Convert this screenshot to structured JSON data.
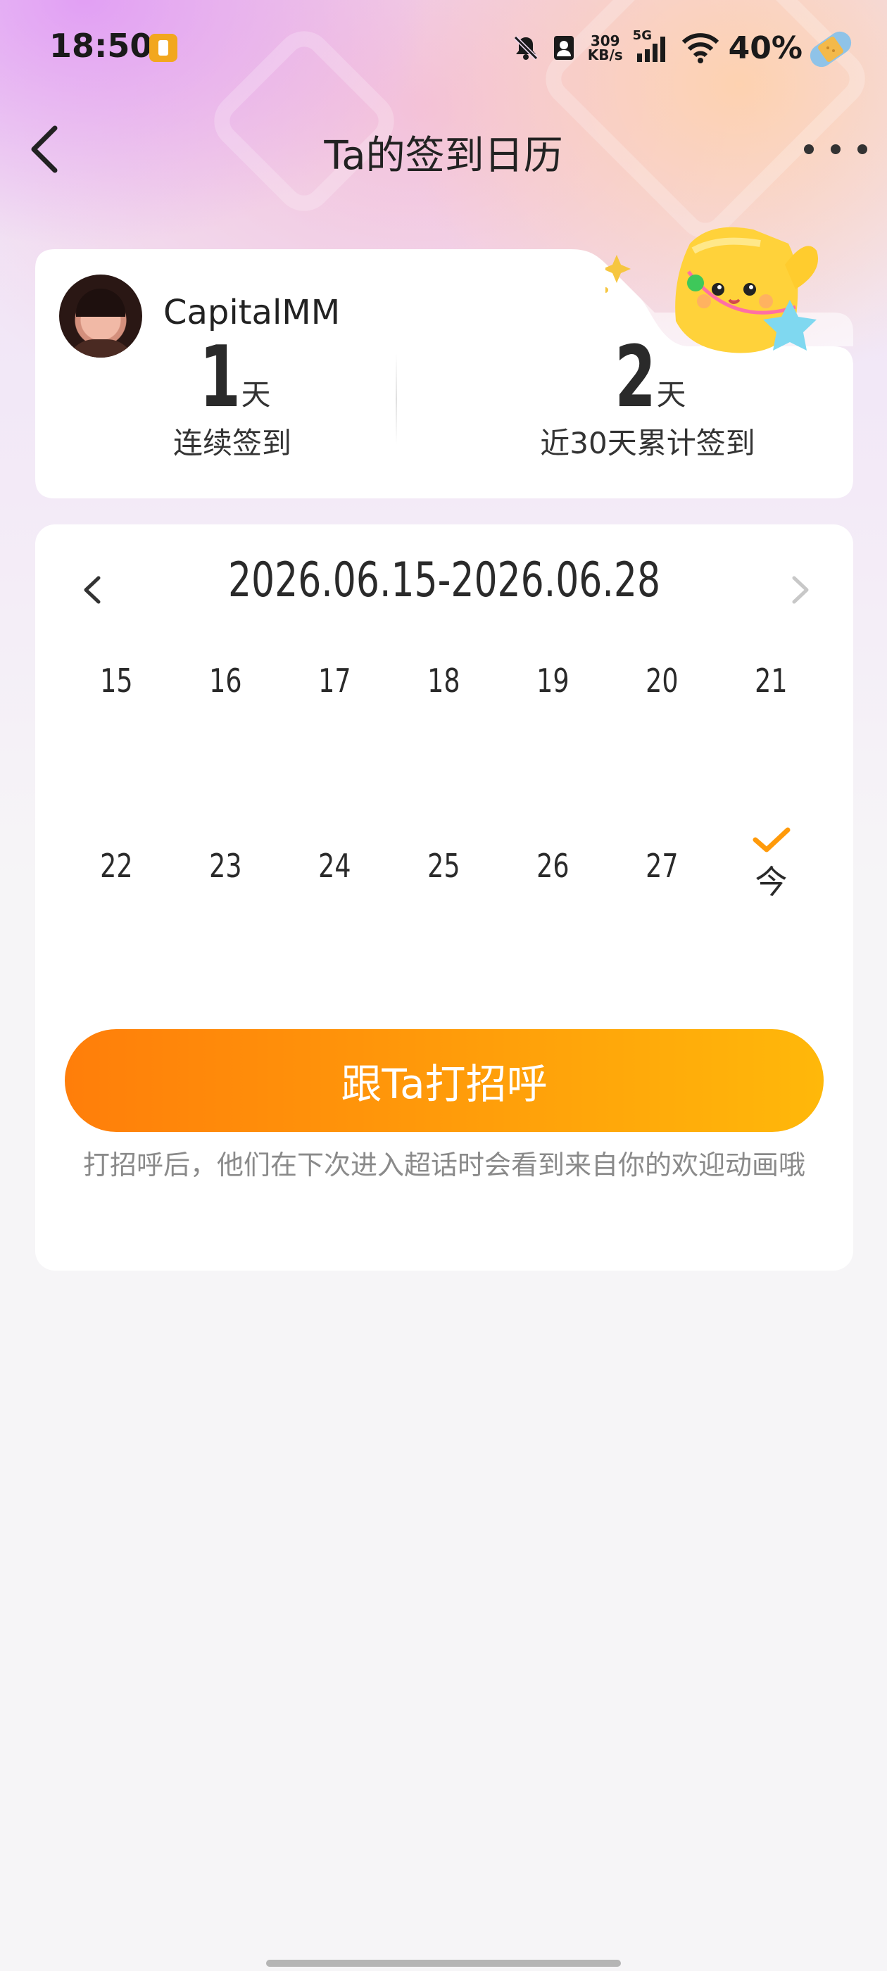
{
  "status_bar": {
    "time": "18:50",
    "net_speed_value": "309",
    "net_speed_unit": "KB/s",
    "network_type": "5G",
    "battery_percent": "40%"
  },
  "nav": {
    "title": "Ta的签到日历"
  },
  "profile": {
    "username": "CapitalMM",
    "consecutive_value": "1",
    "consecutive_unit": "天",
    "consecutive_label": "连续签到",
    "total_value": "2",
    "total_unit": "天",
    "total_label": "近30天累计签到"
  },
  "calendar": {
    "date_range": "2026.06.15-2026.06.28",
    "week1": [
      "15",
      "16",
      "17",
      "18",
      "19",
      "20",
      "21"
    ],
    "week2": [
      "22",
      "23",
      "24",
      "25",
      "26",
      "27"
    ],
    "today_label": "今",
    "accent_color": "#ff9a0a"
  },
  "greet": {
    "button_label": "跟Ta打招呼",
    "hint": "打招呼后，他们在下次进入超话时会看到来自你的欢迎动画哦"
  },
  "colors": {
    "button_gradient_start": "#ff7e0a",
    "button_gradient_end": "#ffb80a"
  }
}
